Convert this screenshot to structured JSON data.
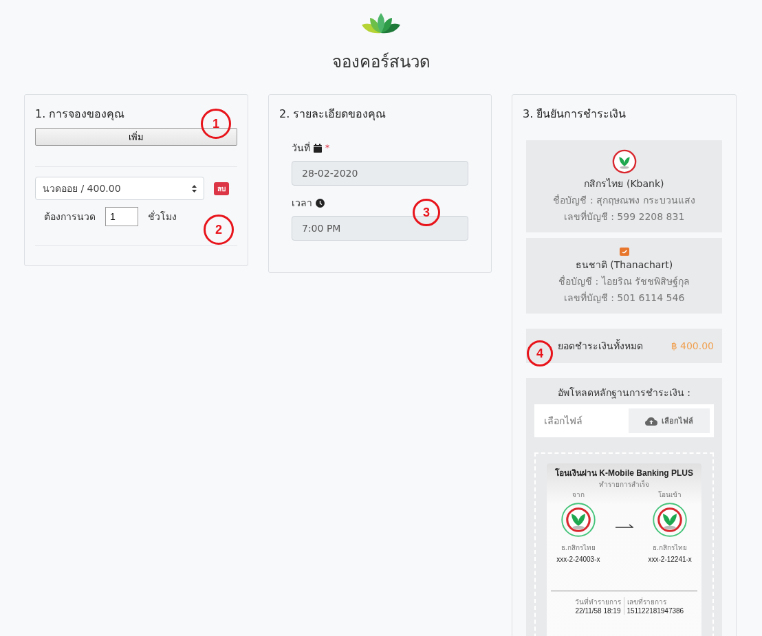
{
  "title": "จองคอร์สนวด",
  "booking": {
    "heading": "1. การจองของคุณ",
    "add_button": "เพิ่ม",
    "items": [
      {
        "service": "นวดออย / 400.00",
        "delete": "ลบ",
        "hours_label": "ต้องการนวด",
        "hours": "1",
        "hours_unit": "ชั่วโมง"
      }
    ]
  },
  "details": {
    "heading": "2. รายละเอียดของคุณ",
    "fields": [
      {
        "label": "วันที่",
        "required_mark": "*",
        "disabled": true,
        "value": "28-02-2020"
      },
      {
        "label": "เวลา",
        "disabled": true,
        "value": "7:00 PM"
      }
    ]
  },
  "payment": {
    "heading": "3. ยืนยันการชำระเงิน",
    "banks": [
      {
        "kind": "kbank",
        "name": "กสิกรไทย (Kbank)",
        "account_name": "ชื่อบัญชี : สุกฤษณพง กระบวนแสง",
        "account_no": "เลขที่บัญชี : 599 2208 831"
      },
      {
        "kind": "thanachart",
        "name": "ธนชาติ (Thanachart)",
        "account_name": "ชื่อบัญชี : ไอยริณ รัชชพิสิษฐ์กุล",
        "account_no": "เลขที่บัญชี : 501 6114 546"
      }
    ],
    "total": {
      "label": "ยอดชำระเงินทั้งหมด",
      "amount": "฿ 400.00"
    },
    "upload": {
      "label": "อัพโหลดหลักฐานการชำระเงิน :",
      "placeholder": "เลือกไฟล์",
      "button": "เลือกไฟล์"
    },
    "slip": {
      "title": "โอนเงินผ่าน K-Mobile Banking PLUS",
      "status": "ทำรายการสำเร็จ",
      "from": {
        "caption": "จาก",
        "bank": "ธ.กสิกรไทย",
        "account": "xxx-2-24003-x"
      },
      "to": {
        "caption": "โอนเข้า",
        "bank": "ธ.กสิกรไทย",
        "account": "xxx-2-12241-x"
      },
      "date_label": "วันที่ทำรายการ",
      "date": "22/11/58 18:19",
      "ref_label": "เลขที่รายการ",
      "ref": "151122181947386"
    }
  },
  "annotations": [
    {
      "label": "1"
    },
    {
      "label": "2"
    },
    {
      "label": "3"
    },
    {
      "label": "4"
    }
  ]
}
